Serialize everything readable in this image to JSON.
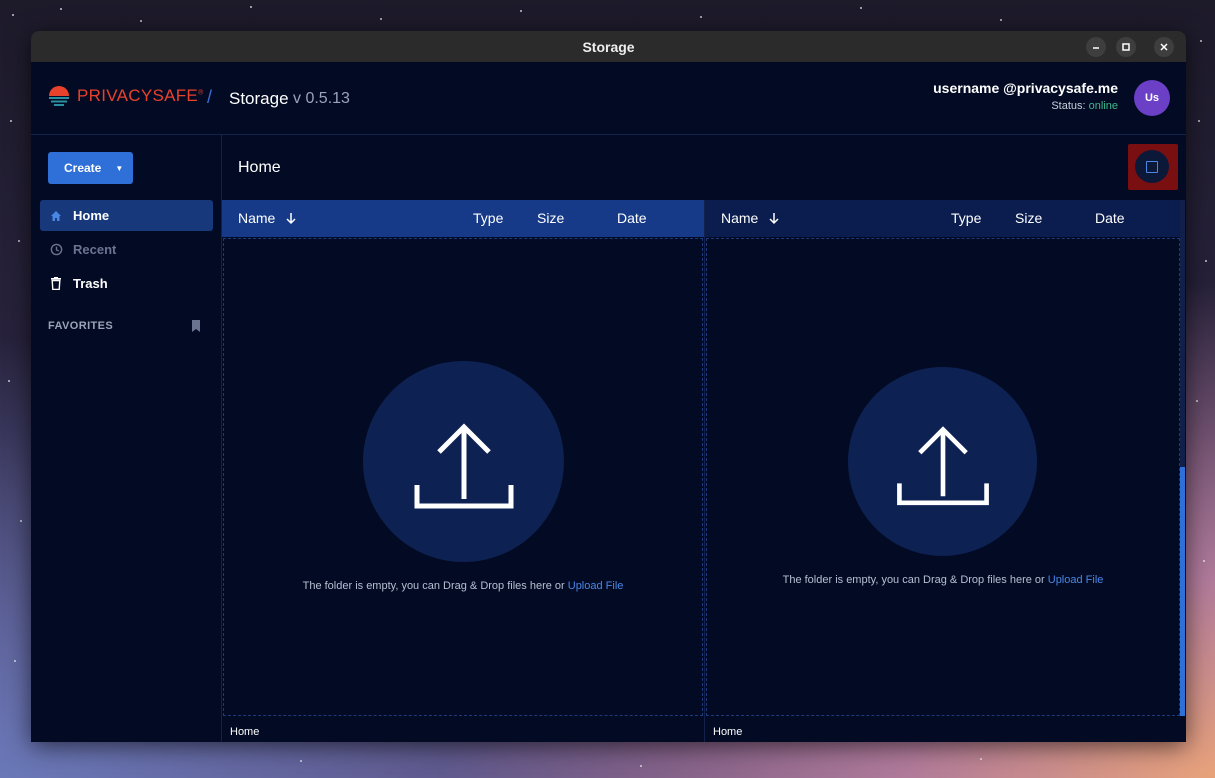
{
  "window": {
    "title": "Storage"
  },
  "header": {
    "brand": "PRIVACYSAFE",
    "brand_mark": "®",
    "separator": "/",
    "app_title": "Storage",
    "app_version": "v 0.5.13",
    "user_name": "username @privacysafe.me",
    "status_label": "Status:",
    "status_value": "online",
    "avatar_initials": "Us"
  },
  "sidebar": {
    "create_label": "Create",
    "items": [
      {
        "label": "Home",
        "icon": "home-icon",
        "active": true
      },
      {
        "label": "Recent",
        "icon": "clock-icon",
        "active": false
      },
      {
        "label": "Trash",
        "icon": "trash-icon",
        "active": false
      }
    ],
    "favorites_label": "FAVORITES"
  },
  "main": {
    "breadcrumb": "Home",
    "panes": [
      {
        "columns": {
          "name": "Name",
          "type": "Type",
          "size": "Size",
          "date": "Date"
        },
        "empty_text": "The folder is empty, you can Drag & Drop files here or ",
        "upload_link": "Upload File",
        "footer": "Home"
      },
      {
        "columns": {
          "name": "Name",
          "type": "Type",
          "size": "Size",
          "date": "Date"
        },
        "empty_text": "The folder is empty, you can Drag & Drop files here or ",
        "upload_link": "Upload File",
        "footer": "Home"
      }
    ]
  },
  "colors": {
    "accent": "#2f6fd8",
    "brand_red": "#e8412c",
    "online_green": "#3fb98c",
    "background": "#030b24"
  }
}
